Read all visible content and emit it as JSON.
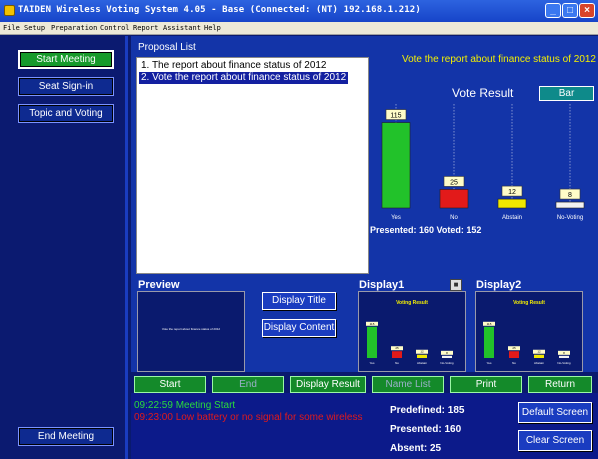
{
  "window": {
    "title": "TAIDEN Wireless Voting System 4.05 - Base (Connected: (NT) 192.168.1.212)",
    "min": "_",
    "max": "□",
    "close": "×"
  },
  "menu": [
    "File",
    "Setup",
    "Preparation",
    "Control",
    "Report",
    "Assistant",
    "Help"
  ],
  "sidebar": {
    "start_meeting": "Start Meeting",
    "seat_signin": "Seat Sign-in",
    "topic_voting": "Topic and Voting",
    "end_meeting": "End Meeting"
  },
  "proposal": {
    "label": "Proposal List",
    "items": [
      "1. The report about finance status of 2012",
      "2. Vote the report about finance status of 2012"
    ]
  },
  "vote": {
    "title": "Vote the report about finance status of 2012",
    "result_label": "Vote Result",
    "view_button": "Bar",
    "stats": "Presented: 160 Voted: 152"
  },
  "chart_data": {
    "type": "bar",
    "categories": [
      "Yes",
      "No",
      "Abstain",
      "No-Voting"
    ],
    "values": [
      115,
      25,
      12,
      8
    ],
    "colors": [
      "#22c22a",
      "#e21a1a",
      "#f0e800",
      "#f2f2f2"
    ],
    "ylim": [
      0,
      140
    ]
  },
  "preview": {
    "label": "Preview",
    "text": "Vote the report about finance status of 2012",
    "display_title": "Display Title",
    "display_content": "Display Content"
  },
  "display1": {
    "label": "Display1",
    "title": "Voting Result"
  },
  "display2": {
    "label": "Display2",
    "title": "Voting Result"
  },
  "commands": {
    "start": "Start",
    "end": "End",
    "display_result": "Display Result",
    "name_list": "Name List",
    "print": "Print",
    "return": "Return"
  },
  "log": {
    "line1": "09:22:59 Meeting Start",
    "line2": "09:23:00 Low battery or no signal for some wireless",
    "line1_color": "#2adc3a",
    "line2_color": "#e21a1a"
  },
  "counts": {
    "predefined": "Predefined: 185",
    "presented": "Presented: 160",
    "absent": "Absent: 25"
  },
  "screen": {
    "default": "Default Screen",
    "clear": "Clear Screen"
  }
}
